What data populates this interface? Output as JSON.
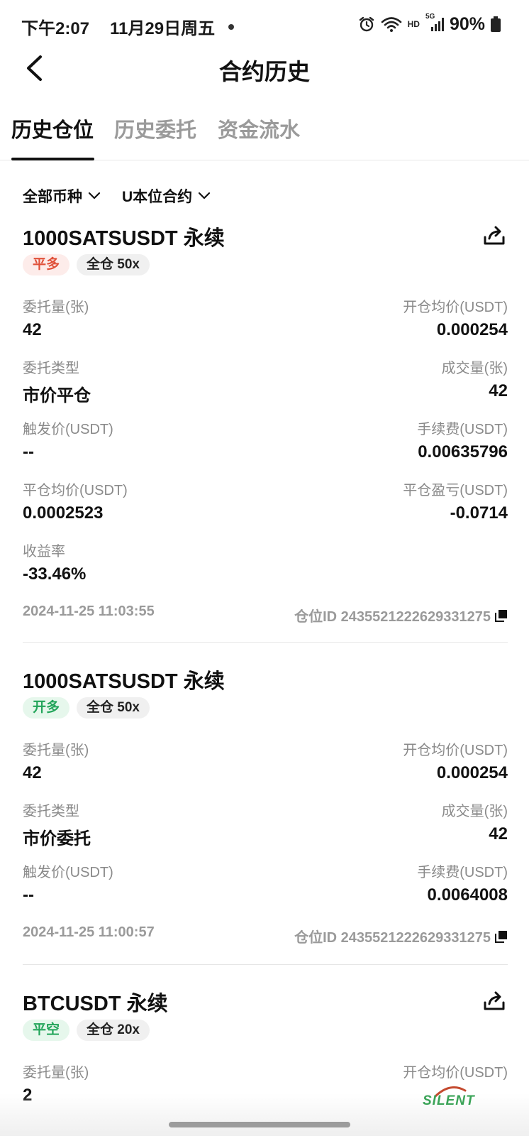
{
  "status_bar": {
    "time": "下午2:07",
    "date": "11月29日周五",
    "network_label": "HD",
    "signal_label": "5G",
    "battery": "90%"
  },
  "header": {
    "title": "合约历史"
  },
  "tabs": [
    {
      "label": "历史仓位",
      "active": true
    },
    {
      "label": "历史委托",
      "active": false
    },
    {
      "label": "资金流水",
      "active": false
    }
  ],
  "filters": {
    "coin": "全部币种",
    "contract": "U本位合约"
  },
  "cards": [
    {
      "title": "1000SATSUSDT 永续",
      "tag_side": "平多",
      "tag_mode": "全仓 50x",
      "fields": [
        {
          "label": "委托量(张)",
          "value": "42"
        },
        {
          "label": "开仓均价(USDT)",
          "value": "0.000254"
        },
        {
          "label": "委托类型",
          "value": "市价平仓"
        },
        {
          "label": "成交量(张)",
          "value": "42"
        },
        {
          "label": "触发价(USDT)",
          "value": "--"
        },
        {
          "label": "手续费(USDT)",
          "value": "0.00635796"
        },
        {
          "label": "平仓均价(USDT)",
          "value": "0.0002523"
        },
        {
          "label": "平仓盈亏(USDT)",
          "value": "-0.0714"
        },
        {
          "label": "收益率",
          "value": "-33.46%"
        }
      ],
      "datetime": "2024-11-25 11:03:55",
      "position_id": "仓位ID 2435521222629331275"
    },
    {
      "title": "1000SATSUSDT 永续",
      "tag_side": "开多",
      "tag_mode": "全仓 50x",
      "fields": [
        {
          "label": "委托量(张)",
          "value": "42"
        },
        {
          "label": "开仓均价(USDT)",
          "value": "0.000254"
        },
        {
          "label": "委托类型",
          "value": "市价委托"
        },
        {
          "label": "成交量(张)",
          "value": "42"
        },
        {
          "label": "触发价(USDT)",
          "value": "--"
        },
        {
          "label": "手续费(USDT)",
          "value": "0.0064008"
        }
      ],
      "datetime": "2024-11-25 11:00:57",
      "position_id": "仓位ID 2435521222629331275"
    },
    {
      "title": "BTCUSDT 永续",
      "tag_side": "平空",
      "tag_mode": "全仓 20x",
      "fields": [
        {
          "label": "委托量(张)",
          "value": "2"
        },
        {
          "label": "开仓均价(USDT)",
          "value": ""
        }
      ]
    }
  ],
  "watermark": "SILENT",
  "colors": {
    "red_tag_bg": "#fdecea",
    "red_tag_text": "#e0513a",
    "green_tag_bg": "#e6f7ec",
    "green_tag_text": "#23a55a"
  }
}
